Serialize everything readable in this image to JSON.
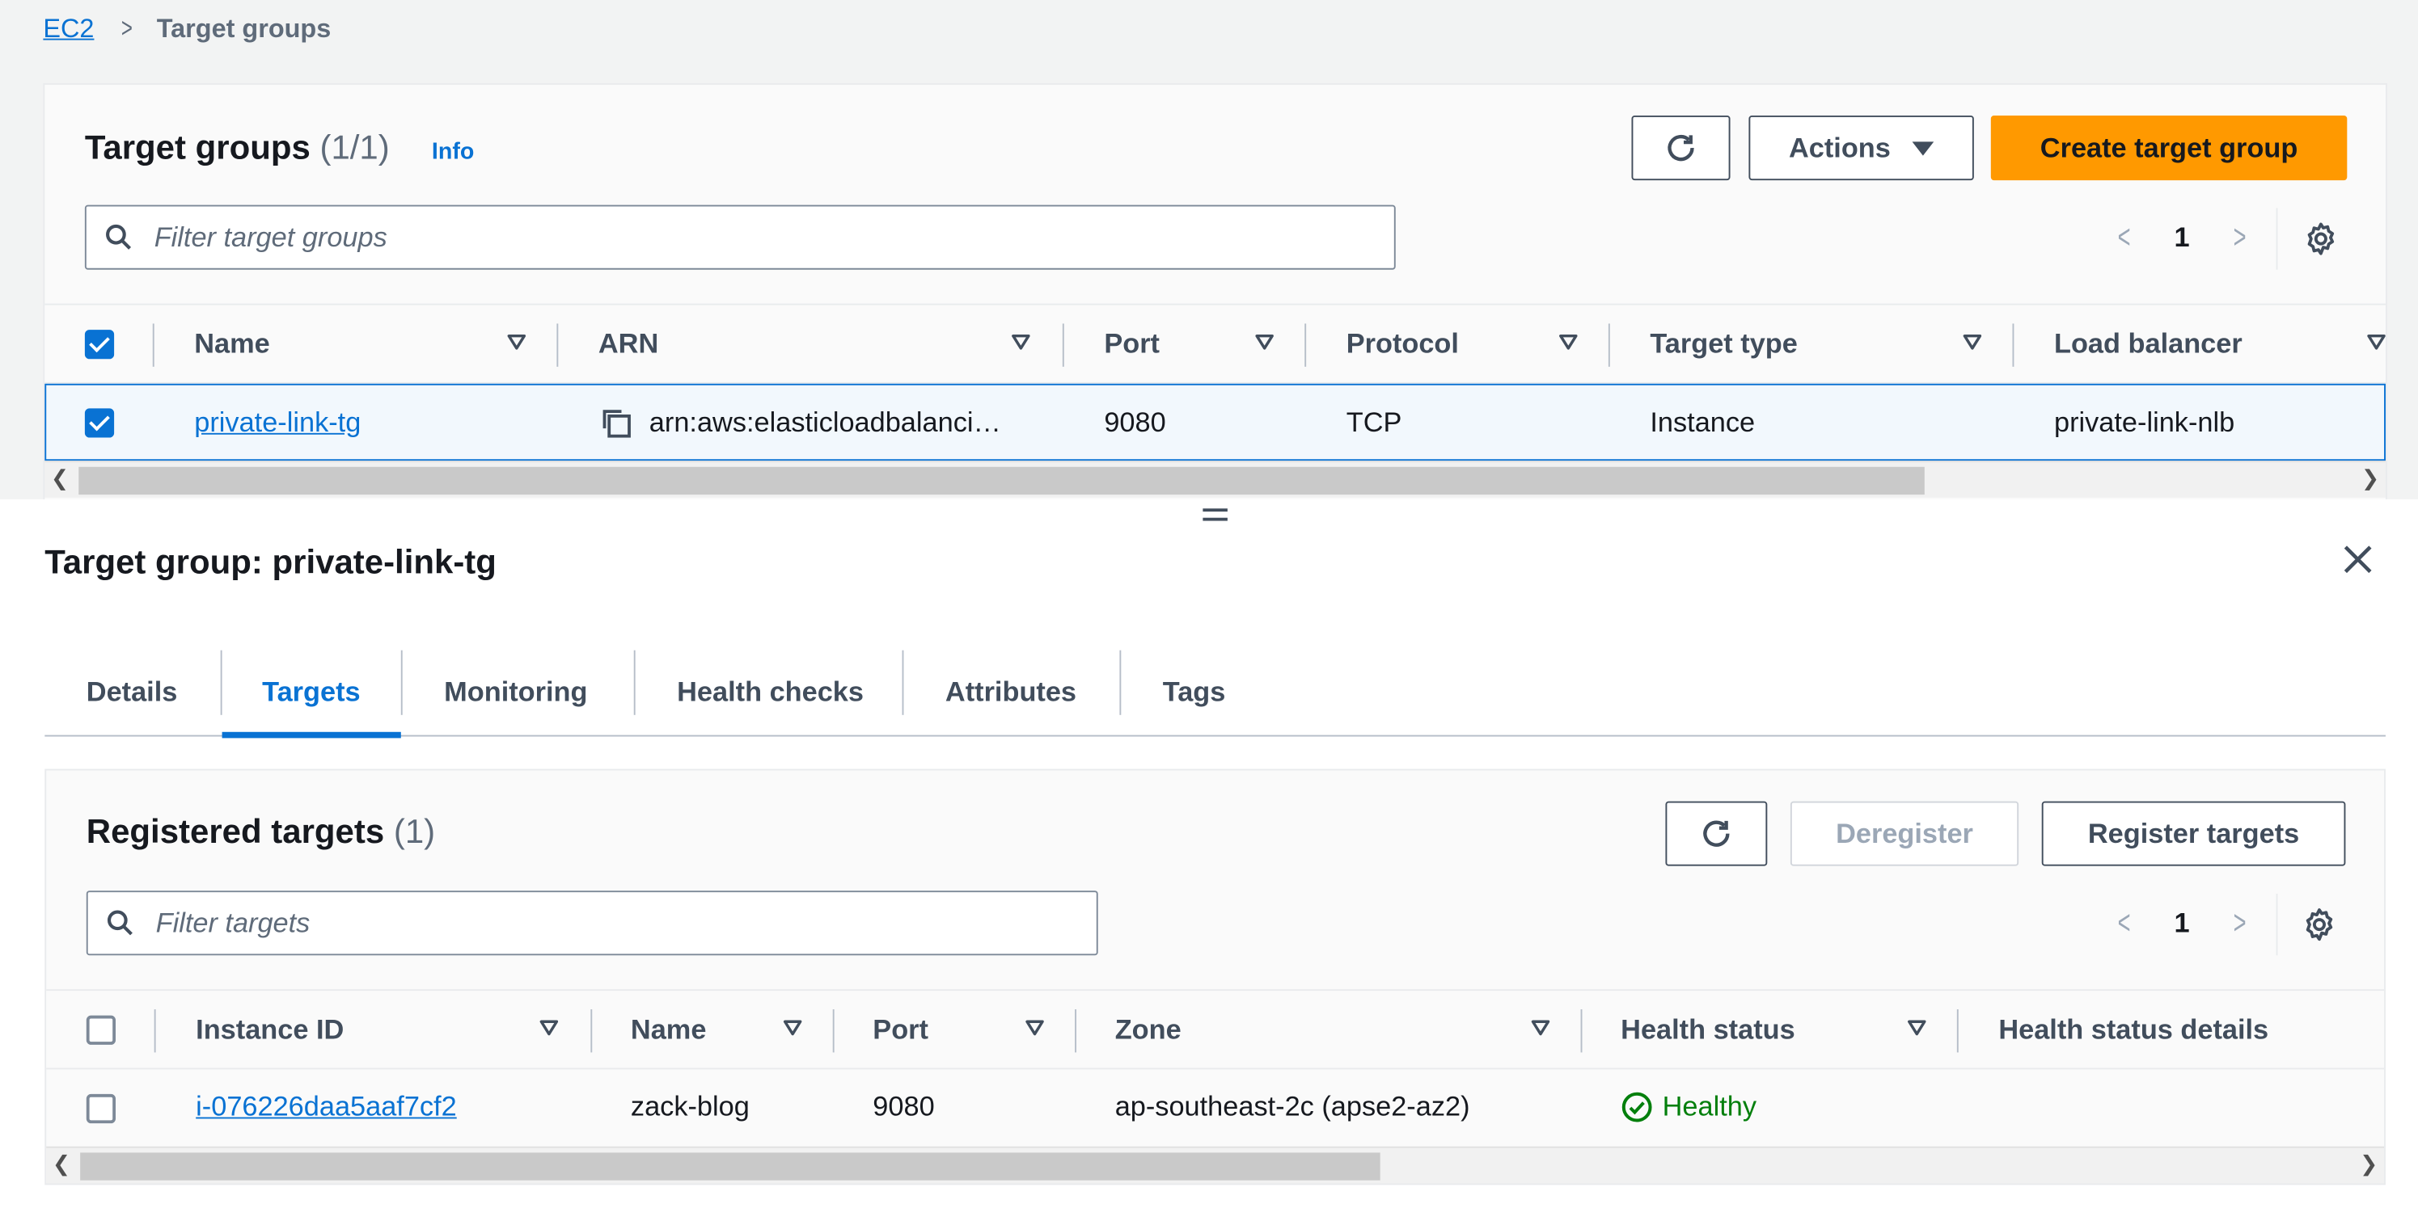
{
  "breadcrumb": {
    "root": "EC2",
    "separator": ">",
    "current": "Target groups"
  },
  "target_groups": {
    "title": "Target groups",
    "count": "(1/1)",
    "info": "Info",
    "actions_label": "Actions",
    "create_label": "Create target group",
    "filter_placeholder": "Filter target groups",
    "page": "1",
    "columns": [
      "Name",
      "ARN",
      "Port",
      "Protocol",
      "Target type",
      "Load balancer"
    ],
    "rows": [
      {
        "name": "private-link-tg",
        "arn": "arn:aws:elasticloadbalanci…",
        "port": "9080",
        "protocol": "TCP",
        "target_type": "Instance",
        "load_balancer": "private-link-nlb",
        "selected": true
      }
    ]
  },
  "detail": {
    "title": "Target group: private-link-tg",
    "tabs": [
      "Details",
      "Targets",
      "Monitoring",
      "Health checks",
      "Attributes",
      "Tags"
    ],
    "active_tab": "Targets"
  },
  "registered_targets": {
    "title": "Registered targets",
    "count": "(1)",
    "deregister_label": "Deregister",
    "register_label": "Register targets",
    "filter_placeholder": "Filter targets",
    "page": "1",
    "columns": [
      "Instance ID",
      "Name",
      "Port",
      "Zone",
      "Health status",
      "Health status details"
    ],
    "rows": [
      {
        "instance_id": "i-076226daa5aaf7cf2",
        "name": "zack-blog",
        "port": "9080",
        "zone": "ap-southeast-2c (apse2-az2)",
        "health": "Healthy",
        "health_details": ""
      }
    ]
  },
  "colors": {
    "link": "#0972d3",
    "primary": "#ff9900",
    "healthy": "#037f0c"
  }
}
